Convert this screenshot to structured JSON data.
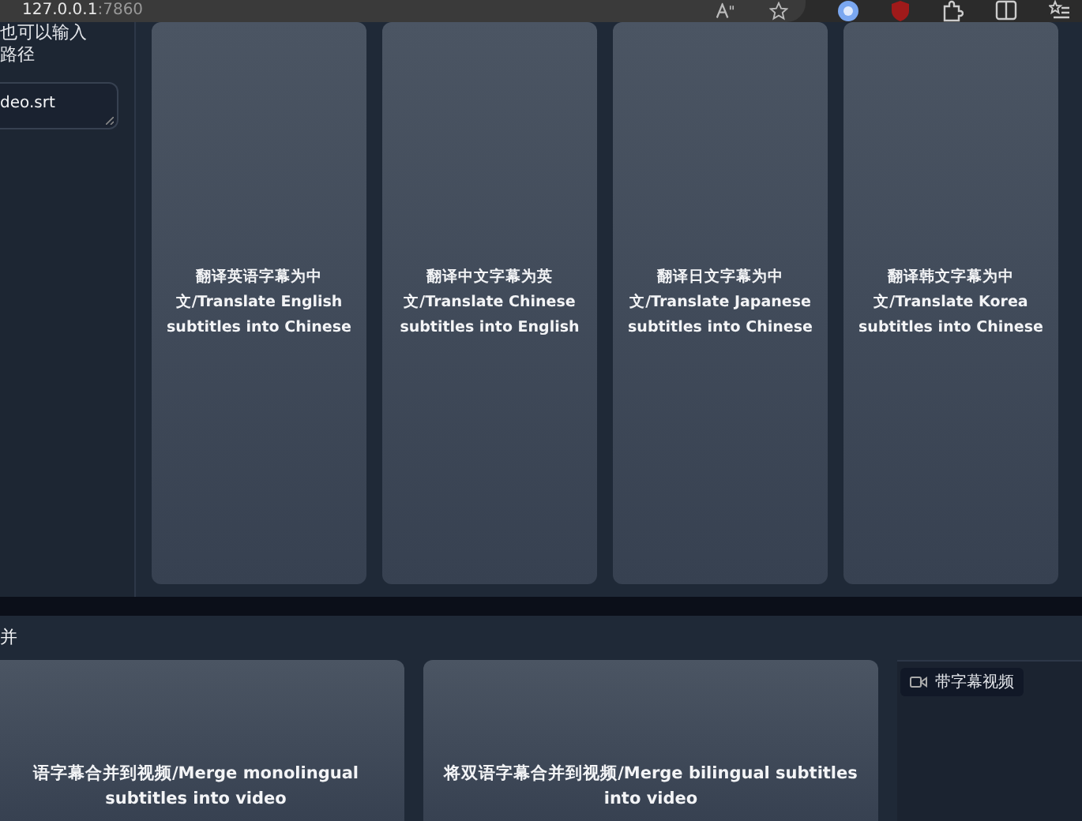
{
  "browser": {
    "url_host": "127.0.0.1",
    "url_port": ":7860"
  },
  "sidebar": {
    "label_line_1": "也可以输入",
    "label_line_2": "路径",
    "textarea_value": "deo.srt"
  },
  "translate_buttons": [
    {
      "label": "翻译英语字幕为中文/Translate English subtitles into Chinese"
    },
    {
      "label": "翻译中文字幕为英文/Translate Chinese subtitles into English"
    },
    {
      "label": "翻译日文字幕为中文/Translate Japanese subtitles into Chinese"
    },
    {
      "label": "翻译韩文字幕为中文/Translate Korea subtitles into Chinese"
    }
  ],
  "merge_section": {
    "title": "并",
    "buttons": [
      {
        "label": "语字幕合并到视频/Merge monolingual subtitles into video"
      },
      {
        "label": "将双语字幕合并到视频/Merge bilingual subtitles into video"
      }
    ],
    "video_label": "带字幕视频"
  }
}
